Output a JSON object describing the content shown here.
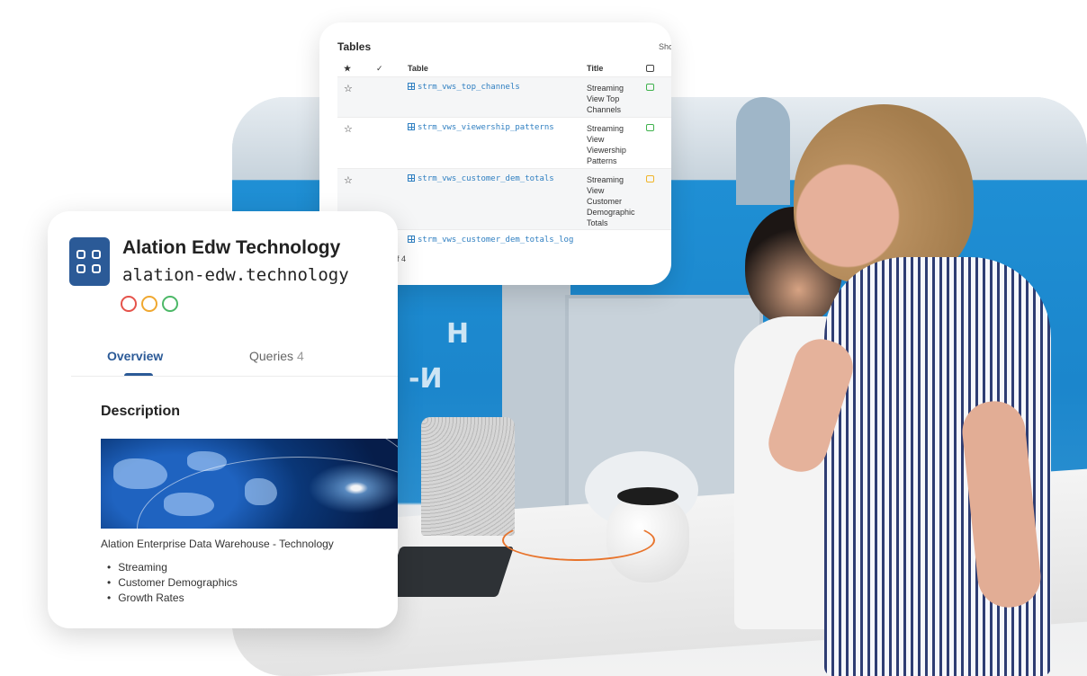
{
  "tables_card": {
    "title": "Tables",
    "show_label": "Sho",
    "headers": {
      "star": "★",
      "check": "✓",
      "table": "Table",
      "title": "Title"
    },
    "rows": [
      {
        "star": "☆",
        "table": "strm_vws_top_channels",
        "title": "Streaming View Top Channels",
        "status": "green"
      },
      {
        "star": "☆",
        "table": "strm_vws_viewership_patterns",
        "title": "Streaming View Viewership Patterns",
        "status": "green"
      },
      {
        "star": "☆",
        "table": "strm_vws_customer_dem_totals",
        "title": "Streaming View Customer Demographic Totals",
        "status": "amber"
      },
      {
        "star": "",
        "table": "strm_vws_customer_dem_totals_log",
        "title": "",
        "status": ""
      }
    ],
    "pager": "f 4"
  },
  "dataset_card": {
    "title": "Alation Edw Technology",
    "subtitle": "alation-edw.technology",
    "quality_dots": [
      "#e5534b",
      "#f0a830",
      "#4cb867"
    ],
    "tabs": [
      {
        "label": "Overview",
        "count": ""
      },
      {
        "label": "Queries",
        "count": "4"
      }
    ],
    "description_heading": "Description",
    "description_text": "Alation Enterprise Data Warehouse - Technology",
    "bullets": [
      "Streaming",
      "Customer Demographics",
      "Growth Rates"
    ]
  },
  "photo_letters": [
    "Н",
    "-И"
  ],
  "colors": {
    "accent": "#2b5a97",
    "link": "#2f7fc1",
    "ok": "#3fb24d",
    "warn": "#f0b429"
  }
}
